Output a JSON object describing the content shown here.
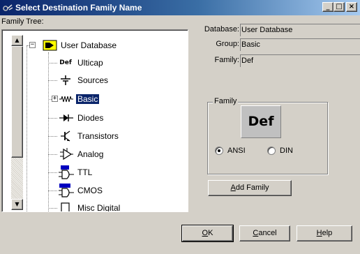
{
  "window": {
    "title": "Select Destination Family Name",
    "minimize_glyph": "_",
    "maximize_glyph": "□",
    "close_glyph": "×"
  },
  "tree": {
    "label": "Family Tree:",
    "root": {
      "label": "User Database",
      "icon": "database-folder-icon",
      "expander": "−"
    },
    "items": [
      {
        "label": "Ulticap",
        "icon": "def-icon",
        "glyph": "Def"
      },
      {
        "label": "Sources",
        "icon": "sources-icon",
        "glyph": "╧"
      },
      {
        "label": "Basic",
        "icon": "resistor-icon",
        "glyph": "∿∿",
        "expander": "+",
        "selected": true
      },
      {
        "label": "Diodes",
        "icon": "diode-icon",
        "glyph": "⊣▷"
      },
      {
        "label": "Transistors",
        "icon": "transistor-icon",
        "glyph": "≺"
      },
      {
        "label": "Analog",
        "icon": "opamp-icon",
        "glyph": "⊳"
      },
      {
        "label": "TTL",
        "icon": "ttl-gate-icon",
        "glyph": "▷"
      },
      {
        "label": "CMOS",
        "icon": "cmos-gate-icon",
        "glyph": "▷"
      },
      {
        "label": "Misc Digital",
        "icon": "misc-digital-icon",
        "glyph": "□"
      }
    ],
    "scroll_up_glyph": "▲",
    "scroll_down_glyph": "▼"
  },
  "details": {
    "database_label": "Database:",
    "database_value": "User Database",
    "group_label": "Group:",
    "group_value": "Basic",
    "family_label": "Family:",
    "family_value": "Def"
  },
  "family_group": {
    "legend": "Family",
    "preview_text": "Def",
    "symbol_standard": {
      "options": [
        "ANSI",
        "DIN"
      ],
      "selected": "ANSI"
    },
    "add_family_pre": "",
    "add_family_key": "A",
    "add_family_rest": "dd Family"
  },
  "footer": {
    "ok_key": "O",
    "ok_rest": "K",
    "cancel_key": "C",
    "cancel_rest": "ancel",
    "help_key": "H",
    "help_rest": "elp"
  },
  "colors": {
    "titlebar_start": "#0a246a",
    "titlebar_end": "#a6caf0",
    "face": "#d4d0c8",
    "selection": "#0a246a",
    "tree_background": "#ffffff"
  }
}
